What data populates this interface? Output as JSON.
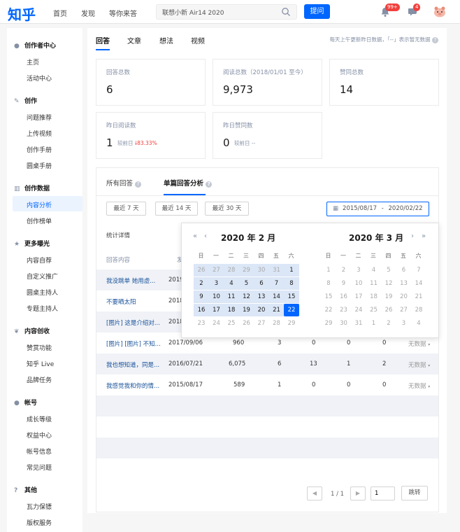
{
  "topbar": {
    "logo": "知乎",
    "nav": [
      "首页",
      "发现",
      "等你来答"
    ],
    "search_value": "联想小新 Air14 2020",
    "ask_label": "提问",
    "notifications_badge": "99+",
    "messages_badge": "4"
  },
  "sidebar": {
    "sections": [
      {
        "title": "创作者中心",
        "icon": "user-icon",
        "items": [
          "主页",
          "活动中心"
        ]
      },
      {
        "title": "创作",
        "icon": "pen-icon",
        "items": [
          "问题推荐",
          "上传视频",
          "创作手册",
          "圆桌手册"
        ]
      },
      {
        "title": "创作数据",
        "icon": "chart-icon",
        "items": [
          "内容分析",
          "创作榜单"
        ]
      },
      {
        "title": "更多曝光",
        "icon": "star-icon",
        "items": [
          "内容自荐",
          "自定义推广",
          "圆桌主持人",
          "专题主持人"
        ]
      },
      {
        "title": "内容创收",
        "icon": "sprout-icon",
        "items": [
          "赞赏功能",
          "知乎 Live",
          "品牌任务"
        ]
      },
      {
        "title": "帐号",
        "icon": "account-icon",
        "items": [
          "成长等级",
          "权益中心",
          "帐号信息",
          "常见问题"
        ]
      },
      {
        "title": "其他",
        "icon": "help-icon",
        "items": [
          "瓦力保镖",
          "版权服务"
        ]
      }
    ],
    "active_item": "内容分析"
  },
  "main": {
    "tabs": [
      "回答",
      "文章",
      "想法",
      "视频"
    ],
    "active_tab": "回答",
    "notice": "每天上午更新昨日数据，「--」表示暂无数据",
    "stats": [
      {
        "label": "回答总数",
        "value": "6"
      },
      {
        "label": "阅读总数（2018/01/01 至今）",
        "value": "9,973"
      },
      {
        "label": "赞同总数",
        "value": "14"
      }
    ],
    "yesterday": [
      {
        "label": "昨日阅读数",
        "value": "1",
        "compare_label": "较前日",
        "change": "83.33%",
        "direction": "down"
      },
      {
        "label": "昨日赞同数",
        "value": "0",
        "compare_label": "较前日",
        "change": "--"
      }
    ]
  },
  "analysis": {
    "tabs": [
      "所有回答",
      "单篇回答分析"
    ],
    "active_tab": "单篇回答分析",
    "range_buttons": [
      "最近 7 天",
      "最近 14 天",
      "最近 30 天"
    ],
    "date_start": "2015/08/17",
    "date_sep": "-",
    "date_end": "2020/02/22",
    "section_title": "统计详情",
    "col_content": "回答内容",
    "col_date": "发",
    "rows": [
      {
        "title": "我没跳单 她用虚...",
        "date": "2019",
        "reads": "",
        "a": "",
        "b": "",
        "c": "",
        "d": "",
        "status": ""
      },
      {
        "title": "不要晒太阳",
        "date": "2018",
        "reads": "",
        "a": "",
        "b": "",
        "c": "",
        "d": "",
        "status": ""
      },
      {
        "title": "[图片] 这是介绍对...",
        "date": "2018",
        "reads": "",
        "a": "",
        "b": "",
        "c": "",
        "d": "",
        "status": ""
      },
      {
        "title": "[图片] [图片] 不知...",
        "date": "2017/09/06",
        "reads": "960",
        "a": "3",
        "b": "0",
        "c": "0",
        "d": "0",
        "status": "无数据"
      },
      {
        "title": "我也想知道，同是...",
        "date": "2016/07/21",
        "reads": "6,075",
        "a": "6",
        "b": "13",
        "c": "1",
        "d": "2",
        "status": "无数据"
      },
      {
        "title": "我感觉我和你的情...",
        "date": "2015/08/17",
        "reads": "589",
        "a": "1",
        "b": "0",
        "c": "0",
        "d": "0",
        "status": "无数据"
      }
    ],
    "pager": {
      "page_text": "1 / 1",
      "page_input": "1",
      "jump_label": "跳转"
    }
  },
  "calendar": {
    "left_title": "2020 年 2 月",
    "right_title": "2020 年 3 月",
    "weekdays": [
      "日",
      "一",
      "二",
      "三",
      "四",
      "五",
      "六"
    ],
    "prev_year": "«",
    "prev_month": "‹",
    "next_month": "›",
    "next_year": "»",
    "left_days": [
      [
        "26",
        "27",
        "28",
        "29",
        "30",
        "31",
        "1"
      ],
      [
        "2",
        "3",
        "4",
        "5",
        "6",
        "7",
        "8"
      ],
      [
        "9",
        "10",
        "11",
        "12",
        "13",
        "14",
        "15"
      ],
      [
        "16",
        "17",
        "18",
        "19",
        "20",
        "21",
        "22"
      ],
      [
        "23",
        "24",
        "25",
        "26",
        "27",
        "28",
        "29"
      ]
    ],
    "right_days": [
      [
        "1",
        "2",
        "3",
        "4",
        "5",
        "6",
        "7"
      ],
      [
        "8",
        "9",
        "10",
        "11",
        "12",
        "13",
        "14"
      ],
      [
        "15",
        "16",
        "17",
        "18",
        "19",
        "20",
        "21"
      ],
      [
        "22",
        "23",
        "24",
        "25",
        "26",
        "27",
        "28"
      ],
      [
        "29",
        "30",
        "31",
        "1",
        "2",
        "3",
        "4"
      ]
    ],
    "selected_day": "22",
    "accent": "#0066ff",
    "range_color": "#dbe6f6"
  }
}
